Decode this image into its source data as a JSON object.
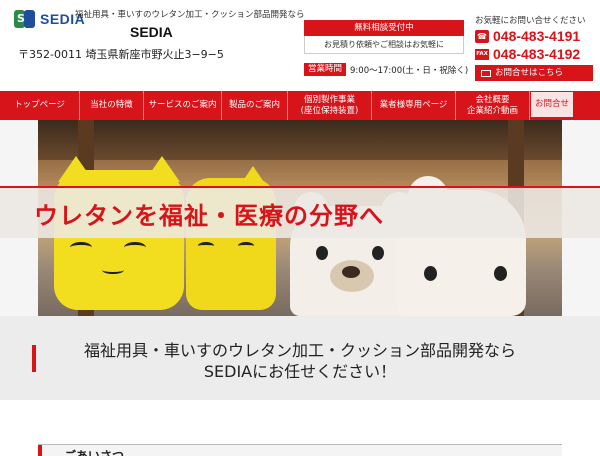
{
  "header": {
    "logo_text": "SEDIA",
    "tagline": "福祉用具・車いすのウレタン加工・クッション部品開発なら",
    "company": "SEDIA",
    "address": "〒352-0011 埼玉県新座市野火止3−9−5",
    "consult": {
      "heading": "無料相談受付中",
      "text": "お見積り依頼やご相談はお気軽に",
      "hours_label": "営業時間",
      "hours": "9:00〜17:00(土・日・祝除く)"
    },
    "contact": {
      "note": "お気軽にお問い合せください",
      "tel": "048-483-4191",
      "fax_label": "FAX",
      "fax": "048-483-4192",
      "mail_label": "お問合せはこちら"
    }
  },
  "nav": {
    "items": [
      {
        "label": "トップページ"
      },
      {
        "label": "当社の特徴"
      },
      {
        "label": "サービスのご案内"
      },
      {
        "label": "製品のご案内"
      },
      {
        "label": "個別製作事業\n(座位保持装置)"
      },
      {
        "label": "業者様専用ページ"
      },
      {
        "label": "会社概要\n企業紹介動画"
      },
      {
        "label": "お問合せ"
      }
    ]
  },
  "hero": {
    "banner": "ウレタンを福祉・医療の分野へ"
  },
  "lead": {
    "line1": "福祉用具・車いすのウレタン加工・クッション部品開発なら",
    "line2": "SEDIAにお任せください！"
  },
  "greeting": {
    "title": "ごあいさつ"
  },
  "colors": {
    "accent": "#d7141a",
    "logo_blue": "#1d4f9c",
    "logo_green": "#2b8a4a"
  }
}
